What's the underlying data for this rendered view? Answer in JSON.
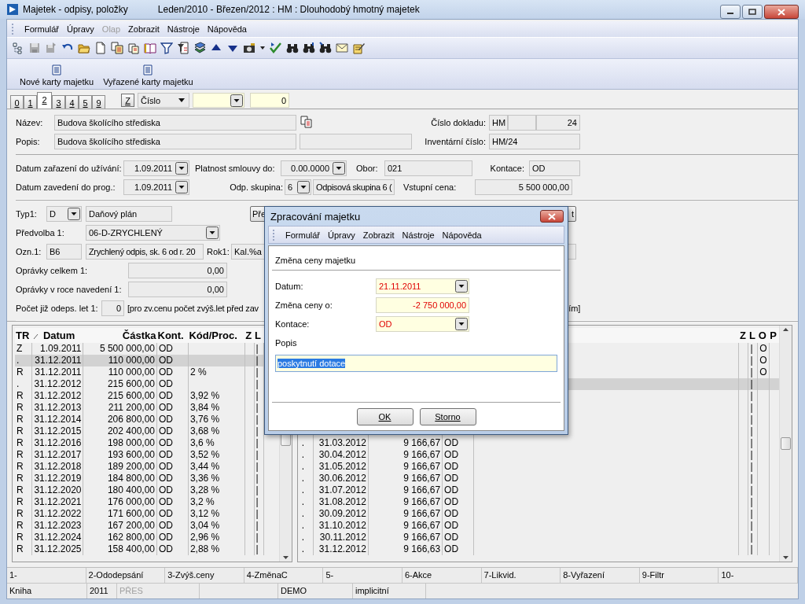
{
  "window": {
    "title": "Majetek - odpisy, položky",
    "subtitle": "Leden/2010 - Březen/2012 : HM : Dlouhodobý hmotný majetek"
  },
  "menu": [
    {
      "label": "Formulář",
      "disabled": false
    },
    {
      "label": "Úpravy",
      "disabled": false
    },
    {
      "label": "Olap",
      "disabled": true
    },
    {
      "label": "Zobrazit",
      "disabled": false
    },
    {
      "label": "Nástroje",
      "disabled": false
    },
    {
      "label": "Nápověda",
      "disabled": false
    }
  ],
  "action_buttons": [
    "Nové karty majetku",
    "Vyřazené karty majetku"
  ],
  "tabs": [
    {
      "label": "0",
      "selected": false
    },
    {
      "label": "1",
      "selected": false
    },
    {
      "label": "2",
      "selected": true
    },
    {
      "label": "3",
      "selected": false
    },
    {
      "label": "4",
      "selected": false
    },
    {
      "label": "5",
      "selected": false
    },
    {
      "label": "9",
      "selected": false
    }
  ],
  "filter": {
    "button": "Z",
    "sort_field": "Číslo",
    "value": "0"
  },
  "form": [
    {
      "rows": [
        {
          "items": [
            {
              "kind": "label",
              "text": "Název:"
            },
            {
              "kind": "field",
              "text": "Budova školícího střediska"
            },
            {
              "kind": "label",
              "text": "Číslo dokladu:"
            },
            {
              "kind": "field",
              "text": "HM"
            },
            {
              "kind": "field"
            },
            {
              "kind": "numfield",
              "text": "24"
            }
          ]
        },
        {
          "items": [
            {
              "kind": "label",
              "text": "Popis:"
            },
            {
              "kind": "field",
              "text": "Budova školícího střediska"
            },
            {
              "kind": "field"
            },
            {
              "kind": "label",
              "text": "Inventární číslo:"
            },
            {
              "kind": "field",
              "text": "HM/24"
            }
          ]
        }
      ]
    },
    {
      "rows": [
        {
          "items": [
            {
              "kind": "label",
              "text": "Datum zařazení do užívání:"
            },
            {
              "kind": "numcombo",
              "text": "1.09.2011"
            },
            {
              "kind": "label",
              "text": "Platnost smlouvy do:"
            },
            {
              "kind": "numcombo",
              "text": "0.00.0000"
            },
            {
              "kind": "label",
              "text": "Obor:"
            },
            {
              "kind": "field",
              "text": "021"
            },
            {
              "kind": "label",
              "text": "Kontace:"
            },
            {
              "kind": "field",
              "text": "OD"
            }
          ]
        },
        {
          "items": [
            {
              "kind": "label",
              "text": "Datum zavedení do prog.:"
            },
            {
              "kind": "numcombo",
              "text": "1.09.2011"
            },
            {
              "kind": "label",
              "text": "Odp. skupina:"
            },
            {
              "kind": "combo",
              "text": "6"
            },
            {
              "kind": "field",
              "text": "Odpisová skupina 6 ("
            },
            {
              "kind": "label",
              "text": "Vstupní cena:"
            },
            {
              "kind": "numfield",
              "text": "5 500 000,00"
            }
          ]
        }
      ]
    },
    {
      "rows": [
        {
          "items": [
            {
              "kind": "label",
              "text": "Typ1:"
            },
            {
              "kind": "combo",
              "text": "D"
            },
            {
              "kind": "field",
              "text": "Daňový plán"
            },
            {
              "kind": "button",
              "text": "Pře"
            },
            {
              "kind": "button",
              "text": "t"
            }
          ]
        },
        {
          "items": [
            {
              "kind": "label",
              "text": "Předvolba 1:"
            },
            {
              "kind": "combo",
              "text": "06-D-ZRYCHLENÝ"
            }
          ]
        },
        {
          "items": [
            {
              "kind": "label",
              "text": "Ozn.1:"
            },
            {
              "kind": "field",
              "text": "B6"
            },
            {
              "kind": "field",
              "text": "Zrychlený odpis, sk. 6 od r. 20"
            },
            {
              "kind": "label",
              "text": "Rok1:"
            },
            {
              "kind": "field",
              "text": "Kal.%a"
            },
            {
              "kind": "field"
            }
          ]
        },
        {
          "items": [
            {
              "kind": "label",
              "text": "Oprávky celkem 1:"
            },
            {
              "kind": "numfield",
              "text": "0,00"
            }
          ]
        },
        {
          "items": [
            {
              "kind": "label",
              "text": "Oprávky v roce navedení 1:"
            },
            {
              "kind": "numfield",
              "text": "0,00"
            }
          ]
        },
        {
          "items": [
            {
              "kind": "label",
              "text": "Počet již odeps. let 1:"
            },
            {
              "kind": "numfield",
              "text": "0"
            },
            {
              "kind": "text",
              "text": "[pro zv.cenu počet zvýš.let před zav"
            },
            {
              "kind": "text",
              "text": "ím]"
            }
          ]
        }
      ]
    }
  ],
  "left_table": {
    "columns": [
      "TR",
      "Datum",
      "Částka",
      "Kont.",
      "Kód/Proc.",
      "Z",
      "L"
    ],
    "rows": [
      {
        "type": "Z",
        "date": "1.09.2011",
        "amount": "5 500 000,00",
        "account": "OD",
        "l": "|",
        "selected": false
      },
      {
        "type": ".",
        "date": "31.12.2011",
        "amount": "110 000,00",
        "account": "OD",
        "l": "|",
        "selected": true
      },
      {
        "type": "R",
        "date": "31.12.2011",
        "amount": "110 000,00",
        "account": "OD",
        "code": "2 %",
        "l": "|",
        "selected": false
      },
      {
        "type": ".",
        "date": "31.12.2012",
        "amount": "215 600,00",
        "account": "OD",
        "l": "|",
        "selected": false
      },
      {
        "type": "R",
        "date": "31.12.2012",
        "amount": "215 600,00",
        "account": "OD",
        "code": "3,92 %",
        "l": "|",
        "selected": false
      },
      {
        "type": "R",
        "date": "31.12.2013",
        "amount": "211 200,00",
        "account": "OD",
        "code": "3,84 %",
        "l": "|",
        "selected": false
      },
      {
        "type": "R",
        "date": "31.12.2014",
        "amount": "206 800,00",
        "account": "OD",
        "code": "3,76 %",
        "l": "|",
        "selected": false
      },
      {
        "type": "R",
        "date": "31.12.2015",
        "amount": "202 400,00",
        "account": "OD",
        "code": "3,68 %",
        "l": "|",
        "selected": false
      },
      {
        "type": "R",
        "date": "31.12.2016",
        "amount": "198 000,00",
        "account": "OD",
        "code": "3,6 %",
        "l": "|",
        "selected": false
      },
      {
        "type": "R",
        "date": "31.12.2017",
        "amount": "193 600,00",
        "account": "OD",
        "code": "3,52 %",
        "l": "|",
        "selected": false
      },
      {
        "type": "R",
        "date": "31.12.2018",
        "amount": "189 200,00",
        "account": "OD",
        "code": "3,44 %",
        "l": "|",
        "selected": false
      },
      {
        "type": "R",
        "date": "31.12.2019",
        "amount": "184 800,00",
        "account": "OD",
        "code": "3,36 %",
        "l": "|",
        "selected": false
      },
      {
        "type": "R",
        "date": "31.12.2020",
        "amount": "180 400,00",
        "account": "OD",
        "code": "3,28 %",
        "l": "|",
        "selected": false
      },
      {
        "type": "R",
        "date": "31.12.2021",
        "amount": "176 000,00",
        "account": "OD",
        "code": "3,2 %",
        "l": "|",
        "selected": false
      },
      {
        "type": "R",
        "date": "31.12.2022",
        "amount": "171 600,00",
        "account": "OD",
        "code": "3,12 %",
        "l": "|",
        "selected": false
      },
      {
        "type": "R",
        "date": "31.12.2023",
        "amount": "167 200,00",
        "account": "OD",
        "code": "3,04 %",
        "l": "|",
        "selected": false
      },
      {
        "type": "R",
        "date": "31.12.2024",
        "amount": "162 800,00",
        "account": "OD",
        "code": "2,96 %",
        "l": "|",
        "selected": false
      },
      {
        "type": "R",
        "date": "31.12.2025",
        "amount": "158 400,00",
        "account": "OD",
        "code": "2,88 %",
        "l": "|",
        "selected": false
      }
    ]
  },
  "right_table": {
    "columns": [
      "Z",
      "L",
      "O",
      "P"
    ],
    "rows": [
      {
        "l": "|",
        "o": "O",
        "selected": false
      },
      {
        "l": "|",
        "o": "O",
        "selected": false
      },
      {
        "l": "|",
        "o": "O",
        "selected": false
      },
      {
        "l": "|",
        "selected": true
      },
      {
        "l": "|",
        "selected": false
      },
      {
        "l": "|",
        "selected": false
      },
      {
        "l": "|",
        "selected": false
      },
      {
        "l": "|",
        "selected": false
      },
      {
        "type": ".",
        "date": "31.03.2012",
        "amount": "9 166,67",
        "account": "OD",
        "l": "|",
        "selected": false
      },
      {
        "type": ".",
        "date": "30.04.2012",
        "amount": "9 166,67",
        "account": "OD",
        "l": "|",
        "selected": false
      },
      {
        "type": ".",
        "date": "31.05.2012",
        "amount": "9 166,67",
        "account": "OD",
        "l": "|",
        "selected": false
      },
      {
        "type": ".",
        "date": "30.06.2012",
        "amount": "9 166,67",
        "account": "OD",
        "l": "|",
        "selected": false
      },
      {
        "type": ".",
        "date": "31.07.2012",
        "amount": "9 166,67",
        "account": "OD",
        "l": "|",
        "selected": false
      },
      {
        "type": ".",
        "date": "31.08.2012",
        "amount": "9 166,67",
        "account": "OD",
        "l": "|",
        "selected": false
      },
      {
        "type": ".",
        "date": "30.09.2012",
        "amount": "9 166,67",
        "account": "OD",
        "l": "|",
        "selected": false
      },
      {
        "type": ".",
        "date": "31.10.2012",
        "amount": "9 166,67",
        "account": "OD",
        "l": "|",
        "selected": false
      },
      {
        "type": ".",
        "date": "30.11.2012",
        "amount": "9 166,67",
        "account": "OD",
        "l": "|",
        "selected": false
      },
      {
        "type": ".",
        "date": "31.12.2012",
        "amount": "9 166,63",
        "account": "OD",
        "l": "|",
        "selected": false
      }
    ]
  },
  "function_keys": [
    "1-",
    "2-Ododepsání",
    "3-Zvýš.ceny",
    "4-ZměnaC",
    "5-",
    "6-Akce",
    "7-Likvid.",
    "8-Vyřazení",
    "9-Filtr",
    "10-"
  ],
  "status_bar": [
    {
      "text": "Kniha",
      "disabled": false
    },
    {
      "text": "2011",
      "disabled": false
    },
    {
      "text": "PŘES",
      "disabled": true
    },
    {
      "text": "DEMO",
      "disabled": false
    },
    {
      "text": "implicitní",
      "disabled": false
    }
  ],
  "dialog": {
    "title": "Zpracování majetku",
    "menu": [
      "Formulář",
      "Úpravy",
      "Zobrazit",
      "Nástroje",
      "Nápověda"
    ],
    "heading": "Změna ceny majetku",
    "fields": [
      {
        "label": "Datum:",
        "value": "21.11.2011",
        "kind": "combo"
      },
      {
        "label": "Změna ceny o:",
        "value": "-2 750 000,00",
        "kind": "number"
      },
      {
        "label": "Kontace:",
        "value": "OD",
        "kind": "combo"
      }
    ],
    "description": {
      "label": "Popis",
      "value": "poskytnutí dotace",
      "selected": true
    },
    "buttons": [
      "OK",
      "Storno"
    ]
  }
}
